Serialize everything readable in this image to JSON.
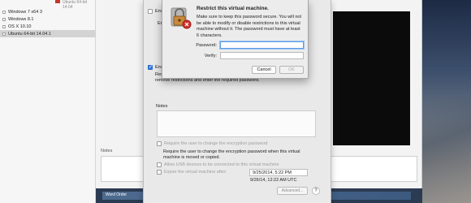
{
  "library": {
    "top_vm_label": "Ubuntu 64-bit 14.04",
    "vms": [
      {
        "label": "Windows 7 x64 3",
        "selected": false
      },
      {
        "label": "Windows 8.1",
        "selected": false
      },
      {
        "label": "OS X 10.10",
        "selected": false
      },
      {
        "label": "Ubuntu 64-bit 14.04.1",
        "selected": true
      }
    ],
    "notes_label": "Notes",
    "dock_label": "Word Order"
  },
  "encryption_sheet": {
    "encrypt_label_1": "Enc",
    "encrypt_label_2": "Enc",
    "encrypt_label_3": "Enc",
    "restrict_line_1": "Restri",
    "restrict_line_2": "remove restrictions and enter the required password.",
    "notes_label": "Notes",
    "require_change_label": "Require the user to change the encryption password",
    "require_change_desc": "Require the user to change the encryption password when this virtual machine is moved or copied.",
    "allow_usb_label": "Allow USB devices to be connected to this virtual machine",
    "expire_label": "Expire the virtual machine after:",
    "expire_date": "9/25/2014,   5:22 PM",
    "expire_time_note": "9/26/14, 12:22 AM UTC",
    "advanced_label": "Advanced...",
    "help_label": "?"
  },
  "dialog": {
    "title": "Restrict this virtual machine.",
    "message": "Make sure to keep this password secure. You will not be able to modify or disable restrictions to this virtual machine without it. The password must have at least 6 characters.",
    "password_label": "Password:",
    "verify_label": "Verify:",
    "cancel_label": "Cancel",
    "ok_label": "OK"
  }
}
